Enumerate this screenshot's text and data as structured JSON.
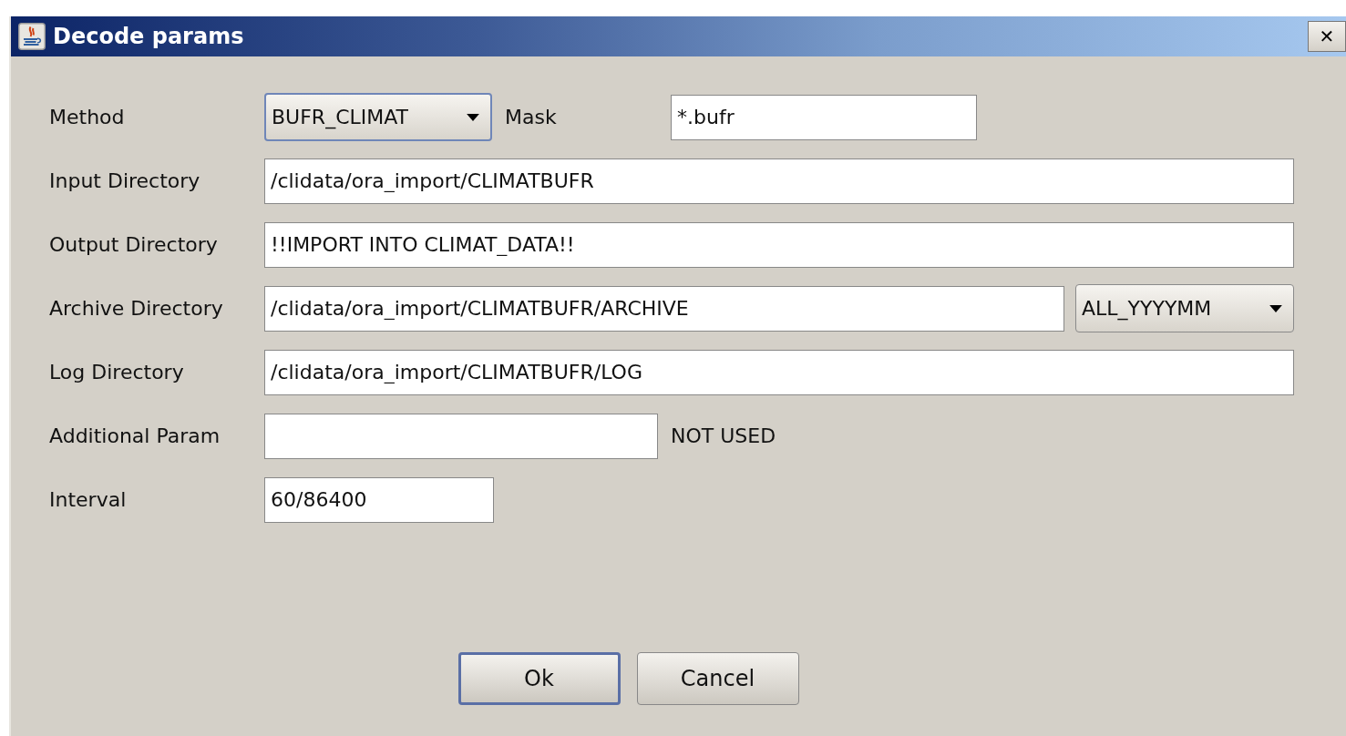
{
  "window": {
    "title": "Decode params",
    "close": "✕"
  },
  "rows": [
    {
      "label": "Method",
      "controls": [
        {
          "kind": "combo",
          "value": "BUFR_CLIMAT"
        },
        {
          "kind": "label",
          "text": "Mask"
        },
        {
          "kind": "field",
          "value": "*.bufr"
        }
      ]
    },
    {
      "label": "Input Directory",
      "controls": [
        {
          "kind": "field",
          "value": "/clidata/ora_import/CLIMATBUFR"
        }
      ]
    },
    {
      "label": "Output Directory",
      "controls": [
        {
          "kind": "field",
          "value": "!!IMPORT INTO CLIMAT_DATA!!"
        }
      ]
    },
    {
      "label": "Archive Directory",
      "controls": [
        {
          "kind": "field",
          "value": "/clidata/ora_import/CLIMATBUFR/ARCHIVE"
        },
        {
          "kind": "combo",
          "value": "ALL_YYYYMM"
        }
      ]
    },
    {
      "label": "Log Directory",
      "controls": [
        {
          "kind": "field",
          "value": "/clidata/ora_import/CLIMATBUFR/LOG"
        }
      ]
    },
    {
      "label": "Additional Param",
      "controls": [
        {
          "kind": "field"
        },
        {
          "kind": "label",
          "text": "NOT USED"
        }
      ]
    },
    {
      "label": "Interval",
      "controls": [
        {
          "kind": "field",
          "value": "60/86400"
        }
      ]
    }
  ],
  "buttons": [
    {
      "label": "Ok",
      "default": true
    },
    {
      "label": "Cancel",
      "default": false
    }
  ]
}
